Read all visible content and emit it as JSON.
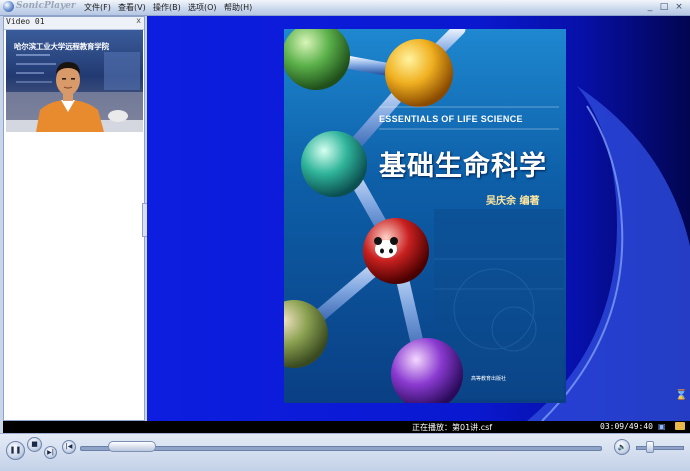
{
  "app": {
    "title": "SonicPlayer"
  },
  "menu": [
    {
      "label": "文件(F)"
    },
    {
      "label": "查看(V)"
    },
    {
      "label": "操作(B)"
    },
    {
      "label": "选项(O)"
    },
    {
      "label": "帮助(H)"
    }
  ],
  "window_controls": {
    "minimize": "_",
    "maximize": "□",
    "close": "×"
  },
  "video_panel": {
    "title": "Video 01",
    "close": "x",
    "caption": "哈尔滨工业大学远程教育学院"
  },
  "book": {
    "subtitle": "ESSENTIALS OF LIFE SCIENCE",
    "title": "基础生命科学",
    "author": "吴庆余  编著",
    "publisher": "高等教育出版社"
  },
  "status": {
    "playing_label": "正在播放",
    "current_file": "第01讲.csf",
    "separator": "：",
    "time": "03:09/49:40"
  },
  "controls": {
    "seek_fraction": 0.06,
    "volume_fraction": 0.25
  }
}
